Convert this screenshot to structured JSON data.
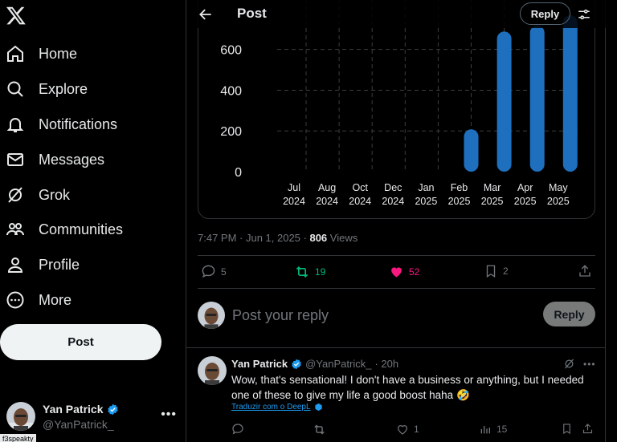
{
  "sidebar": {
    "items": [
      {
        "label": "Home",
        "icon": "home-icon"
      },
      {
        "label": "Explore",
        "icon": "search-icon"
      },
      {
        "label": "Notifications",
        "icon": "bell-icon"
      },
      {
        "label": "Messages",
        "icon": "envelope-icon"
      },
      {
        "label": "Grok",
        "icon": "grok-icon"
      },
      {
        "label": "Communities",
        "icon": "people-icon"
      },
      {
        "label": "Profile",
        "icon": "person-icon"
      },
      {
        "label": "More",
        "icon": "more-circle-icon"
      }
    ],
    "post_label": "Post",
    "account": {
      "name": "Yan Patrick",
      "handle": "@YanPatrick_"
    },
    "tooltip": "f3speakty"
  },
  "header": {
    "title": "Post",
    "reply_label": "Reply"
  },
  "chart_data": {
    "type": "bar",
    "categories": [
      "Jul\n2024",
      "Aug\n2024",
      "Oct\n2024",
      "Dec\n2024",
      "Jan\n2025",
      "Feb\n2025",
      "Mar\n2025",
      "Apr\n2025",
      "May\n2025"
    ],
    "x_labels_top": [
      "Jul",
      "Aug",
      "Oct",
      "Dec",
      "Jan",
      "Feb",
      "Mar",
      "Apr",
      "May"
    ],
    "x_labels_bottom": [
      "2024",
      "2024",
      "2024",
      "2024",
      "2025",
      "2025",
      "2025",
      "2025",
      "2025"
    ],
    "values": [
      0,
      0,
      0,
      0,
      0,
      200,
      680,
      710,
      760
    ],
    "y_ticks": [
      "0",
      "200",
      "400",
      "600"
    ],
    "ylim": [
      0,
      760
    ],
    "grid": true,
    "bar_color": "#1f6fbf"
  },
  "post_meta": {
    "time": "7:47 PM · Jun 1, 2025 · ",
    "views_count": "806",
    "views_label": " Views"
  },
  "actions": {
    "replies": "5",
    "reposts": "19",
    "likes": "52",
    "bookmarks": "2"
  },
  "reply_box": {
    "placeholder": "Post your reply",
    "button": "Reply"
  },
  "comment": {
    "name": "Yan Patrick",
    "handle": "@YanPatrick_",
    "time": "· 20h",
    "text": "Wow, that's sensational! I don't have a business or anything, but I needed one of these to give my life a good boost haha 🤣",
    "translate": "Traduzir com o DeepL",
    "reposts": "",
    "likes": "1",
    "views": "15"
  },
  "colors": {
    "accent": "#1d9bf0",
    "repost": "#00ba7c",
    "like": "#f91880"
  }
}
